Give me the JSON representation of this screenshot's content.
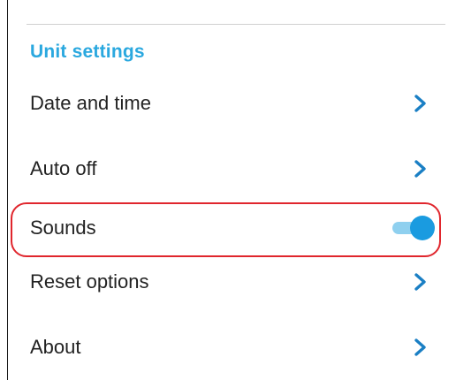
{
  "section": {
    "title": "Unit settings"
  },
  "items": [
    {
      "label": "Date and time",
      "control": "chevron-right-icon"
    },
    {
      "label": "Auto off",
      "control": "chevron-right-icon"
    },
    {
      "label": "Sounds",
      "control": "toggle",
      "toggle_on": true,
      "highlighted": true
    },
    {
      "label": "Reset options",
      "control": "chevron-right-icon"
    },
    {
      "label": "About",
      "control": "chevron-right-icon"
    }
  ],
  "colors": {
    "section_title": "#2aa8df",
    "chevron": "#1a7fc4",
    "toggle_knob": "#1a9be0",
    "toggle_track": "#8fd0ef",
    "highlight_outline": "#e0262d"
  }
}
